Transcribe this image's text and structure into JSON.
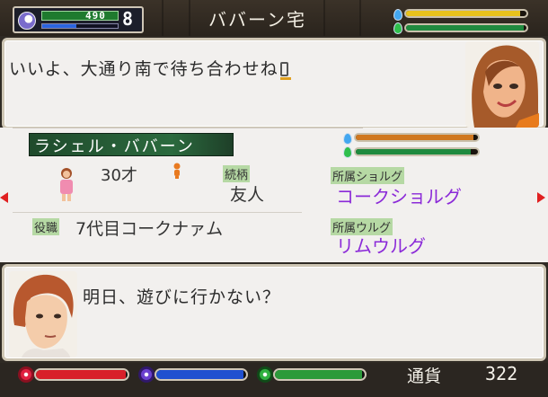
{
  "header": {
    "hp_value": "490",
    "level": "8",
    "mp_fraction": 0.45,
    "location_title": "ババーン宅",
    "gauge_top_fraction": 0.95,
    "gauge_bottom_fraction": 0.98
  },
  "dialogue_top": {
    "message": "いいよ、大通り南で待ち合わせね"
  },
  "profile": {
    "name": "ラシェル・ババーン",
    "age": "30才",
    "relation_label": "続柄",
    "relation_value": "友人",
    "job_label": "役職",
    "job_value": "7代目コークナァム",
    "affiliation1_label": "所属ショルグ",
    "affiliation1_value": "コークショルグ",
    "affiliation2_label": "所属ウルグ",
    "affiliation2_value": "リムウルグ",
    "gauge_top_fraction": 0.96,
    "gauge_bottom_fraction": 0.94
  },
  "dialogue_bottom": {
    "message": "明日、遊びに行かない？"
  },
  "footer": {
    "bar1_fraction": 0.98,
    "bar2_fraction": 0.97,
    "bar3_fraction": 0.97,
    "money_label": "通貨",
    "money_value": "322"
  },
  "colors": {
    "affiliation_text": "#8b2ad8",
    "relation_text": "#333333",
    "bar_red": "#d8202a",
    "bar_blue": "#2050d0",
    "bar_green": "#2c9a3a",
    "gauge_yellow": "#e8c21c",
    "gauge_green": "#1f8a3f",
    "gauge_orange": "#d07820"
  }
}
